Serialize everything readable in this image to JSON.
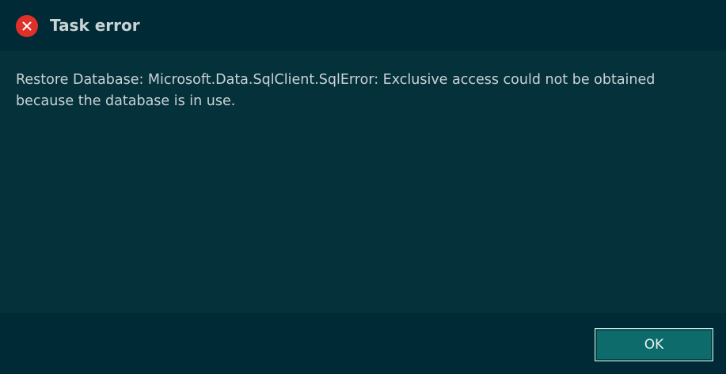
{
  "dialog": {
    "title": "Task error",
    "icon": "error-circle-icon",
    "message": "Restore Database: Microsoft.Data.SqlClient.SqlError: Exclusive access could not be obtained because the database is in use.",
    "ok_label": "OK"
  },
  "colors": {
    "background": "#002b36",
    "body_background": "#05313b",
    "text": "#c9d3d6",
    "error_icon": "#e0302a",
    "button_background": "#0e6b6b"
  }
}
